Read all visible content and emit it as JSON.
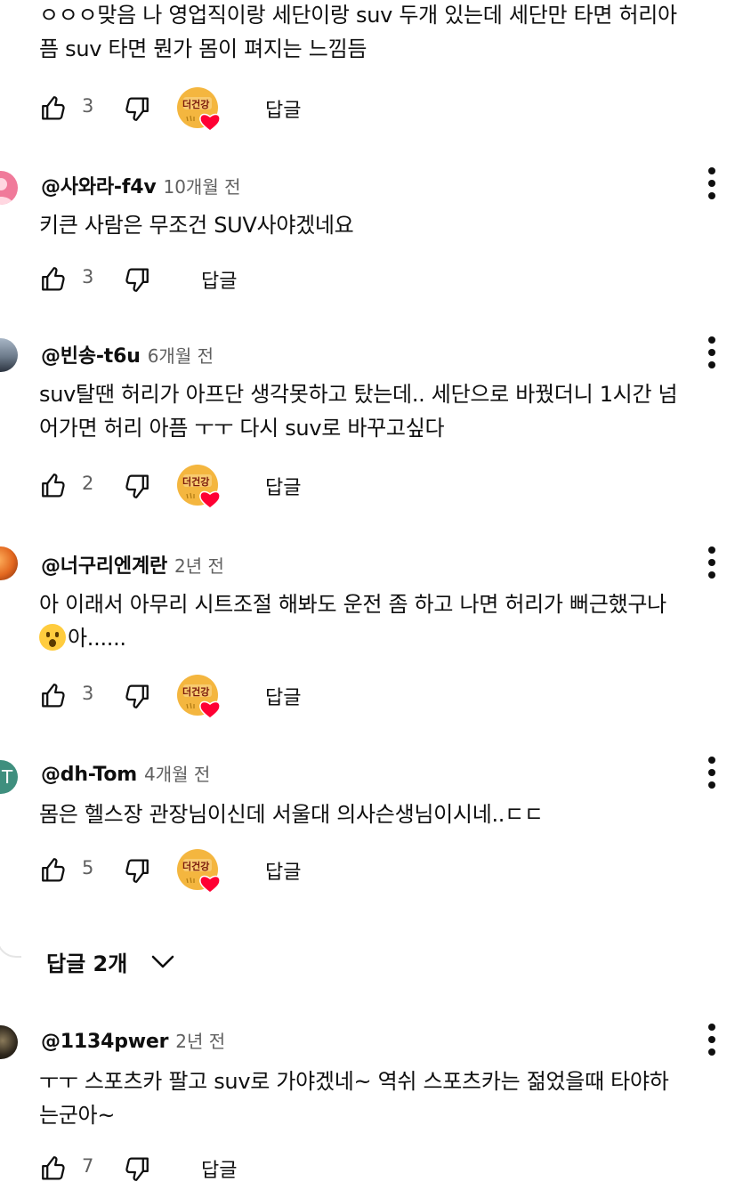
{
  "comments": [
    {
      "text": "ㅇㅇㅇ맞음 나 영업직이랑 세단이랑 suv 두개 있는데 세단만 타면 허리아프 suv 타면 뭔가 몸이 펴지는 느낌듬",
      "line1": "ㅇㅇㅇ맞음 나 영업직이랑 세단이랑 suv 두개 있는데 세단만 타면 허리아",
      "line2": "픔 suv 타면 뭔가 몸이 펴지는 느낌듬",
      "likes": "3",
      "reply_label": "답글"
    },
    {
      "author": "@사와라-f4v",
      "time": "10개월 전",
      "line1": "키큰 사람은 무조건 SUV사야겠네요",
      "likes": "3",
      "reply_label": "답글"
    },
    {
      "author": "@빈송-t6u",
      "time": "6개월 전",
      "line1": "suv탈땐 허리가 아프단 생각못하고 탔는데.. 세단으로 바꿨더니 1시간 넘",
      "line2": "어가면 허리 아픔 ㅜㅜ 다시 suv로 바꾸고싶다",
      "likes": "2",
      "reply_label": "답글"
    },
    {
      "author": "@너구리엔계란",
      "time": "2년 전",
      "line1": "아 이래서 아무리 시트조절 해봐도 운전 좀 하고 나면 허리가 뻐근했구나",
      "line2": "아......",
      "likes": "3",
      "reply_label": "답글"
    },
    {
      "author": "@dh-Tom",
      "time": "4개월 전",
      "line1": "몸은 헬스장 관장님이신데 서울대 의사슨생님이시네..ㄷㄷ",
      "likes": "5",
      "reply_label": "답글"
    },
    {
      "author": "@1134pwer",
      "time": "2년 전",
      "line1": "ㅜㅜ 스포츠카 팔고 suv로 가야겠네~ 역쉬 스포츠카는 젊었을때 타야하",
      "line2": "는군아~",
      "likes": "7",
      "reply_label": "답글"
    }
  ],
  "replies_toggle": {
    "label": "답글 2개"
  },
  "creator_badge": {
    "logo_text": "더건강"
  },
  "icons": {
    "like": "thumb-up-icon",
    "dislike": "thumb-down-icon",
    "more": "more-vert-icon",
    "expand": "chevron-down-icon",
    "heart": "creator-heart-icon"
  },
  "colors": {
    "text": "#0f0f0f",
    "secondary": "#606060",
    "heart": "#ff0033",
    "badge": "#f4b63f"
  }
}
